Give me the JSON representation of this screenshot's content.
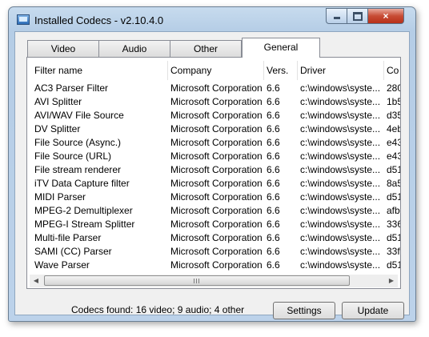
{
  "window": {
    "title": "Installed Codecs  -  v2.10.4.0",
    "close_glyph": "×"
  },
  "tabs": [
    {
      "label": "Video"
    },
    {
      "label": "Audio"
    },
    {
      "label": "Other"
    },
    {
      "label": "General",
      "active": true
    }
  ],
  "table": {
    "columns": [
      "Filter name",
      "Company",
      "Vers.",
      "Driver",
      "Co"
    ],
    "rows": [
      [
        "AC3 Parser Filter",
        "Microsoft Corporation",
        "6.6",
        "c:\\windows\\syste...",
        "280"
      ],
      [
        "AVI Splitter",
        "Microsoft Corporation",
        "6.6",
        "c:\\windows\\syste...",
        "1b5"
      ],
      [
        "AVI/WAV File Source",
        "Microsoft Corporation",
        "6.6",
        "c:\\windows\\syste...",
        "d35"
      ],
      [
        "DV Splitter",
        "Microsoft Corporation",
        "6.6",
        "c:\\windows\\syste...",
        "4eb"
      ],
      [
        "File Source (Async.)",
        "Microsoft Corporation",
        "6.6",
        "c:\\windows\\syste...",
        "e43"
      ],
      [
        "File Source (URL)",
        "Microsoft Corporation",
        "6.6",
        "c:\\windows\\syste...",
        "e43"
      ],
      [
        "File stream renderer",
        "Microsoft Corporation",
        "6.6",
        "c:\\windows\\syste...",
        "d51"
      ],
      [
        "iTV Data Capture filter",
        "Microsoft Corporation",
        "6.6",
        "c:\\windows\\syste...",
        "8a5"
      ],
      [
        "MIDI Parser",
        "Microsoft Corporation",
        "6.6",
        "c:\\windows\\syste...",
        "d51"
      ],
      [
        "MPEG-2 Demultiplexer",
        "Microsoft Corporation",
        "6.6",
        "c:\\windows\\syste...",
        "afb"
      ],
      [
        "MPEG-I Stream Splitter",
        "Microsoft Corporation",
        "6.6",
        "c:\\windows\\syste...",
        "336"
      ],
      [
        "Multi-file Parser",
        "Microsoft Corporation",
        "6.6",
        "c:\\windows\\syste...",
        "d51"
      ],
      [
        "SAMI (CC) Parser",
        "Microsoft Corporation",
        "6.6",
        "c:\\windows\\syste...",
        "33f"
      ],
      [
        "Wave Parser",
        "Microsoft Corporation",
        "6.6",
        "c:\\windows\\syste...",
        "d51"
      ]
    ]
  },
  "scrollbar": {
    "left_arrow": "◀",
    "right_arrow": "▶"
  },
  "status": {
    "text": "Codecs found: 16 video; 9 audio; 4 other"
  },
  "buttons": {
    "settings": "Settings",
    "update": "Update"
  }
}
